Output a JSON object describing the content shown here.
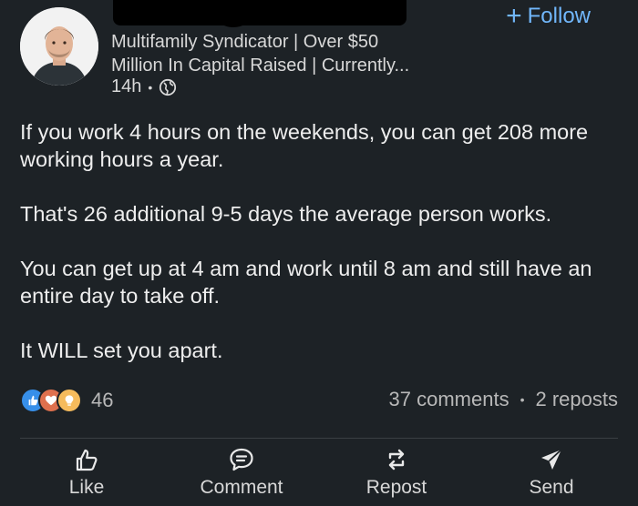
{
  "author": {
    "headline_line1": "Multifamily Syndicator | Over $50",
    "headline_line2": "Million In Capital Raised | Currently...",
    "time": "14h",
    "visibility_icon": "globe-icon"
  },
  "follow": {
    "label": "Follow",
    "plus": "+"
  },
  "post": {
    "paragraphs": [
      "If you work 4 hours on the weekends, you can get 208 more working hours a year.",
      "That's 26 additional 9-5 days the average person works.",
      "You can get up at 4 am and work until 8 am and still have an entire day to take off.",
      "It WILL set you apart."
    ]
  },
  "social": {
    "reaction_icons": [
      "like-icon",
      "love-icon",
      "insightful-icon"
    ],
    "reaction_count": "46",
    "comments": "37 comments",
    "reposts": "2 reposts"
  },
  "actions": {
    "like": "Like",
    "comment": "Comment",
    "repost": "Repost",
    "send": "Send"
  },
  "colors": {
    "background": "#1d2226",
    "accent": "#71b7fb"
  }
}
